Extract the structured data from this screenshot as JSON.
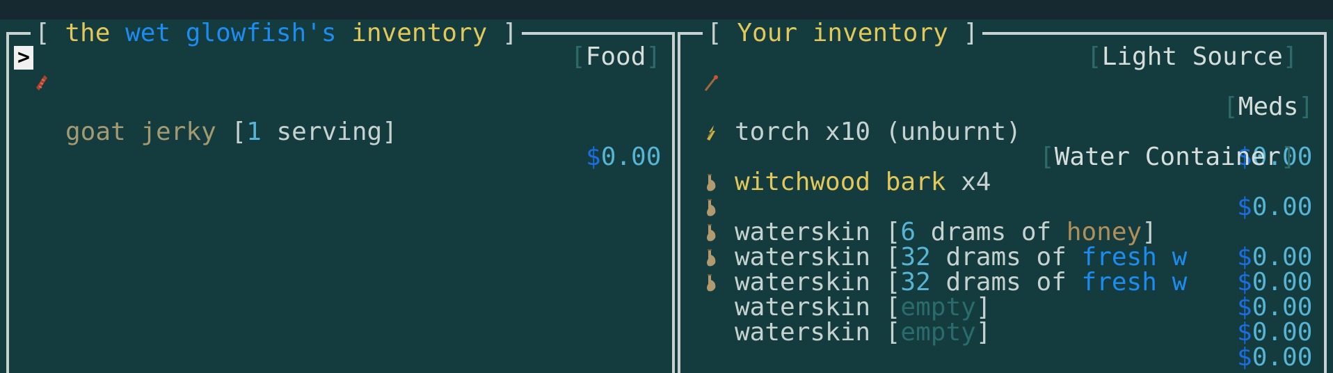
{
  "left": {
    "title_prefix": "[ ",
    "title_the": "the",
    "title_creature": "wet glowfish's",
    "title_inv": "inventory",
    "title_suffix": " ]",
    "cursor": ">",
    "category": "Food",
    "items": [
      {
        "icon": "jerky-icon",
        "name": "goat jerky",
        "detail_open": " [",
        "detail_val": "1",
        "detail_rest": " serving]",
        "price": "0.00"
      }
    ]
  },
  "right": {
    "title_prefix": "[ ",
    "title_text": "Your inventory",
    "title_suffix": " ]",
    "categories": [
      "Light Source",
      "Meds",
      "Water Container"
    ],
    "torch": {
      "name": "torch x10 (unburnt)",
      "price": "0.00"
    },
    "bark": {
      "name": "witchwood bark",
      "qty": " x4",
      "price": "0.00"
    },
    "waterskins": [
      {
        "prefix": "waterskin [",
        "num": "6",
        "mid": " drams of ",
        "liquid": "honey",
        "end": "]",
        "price": "0.00"
      },
      {
        "prefix": "waterskin [",
        "num": "32",
        "mid": " drams of ",
        "liquid": "fresh w",
        "end": "",
        "price": "0.00"
      },
      {
        "prefix": "waterskin [",
        "num": "32",
        "mid": " drams of ",
        "liquid": "fresh w",
        "end": "",
        "price": "0.00"
      },
      {
        "prefix": "waterskin [",
        "num": "",
        "mid": "",
        "liquid": "empty",
        "end": "]",
        "price": "0.00"
      },
      {
        "prefix": "waterskin [",
        "num": "",
        "mid": "",
        "liquid": "empty",
        "end": "]",
        "price": "0.00"
      }
    ]
  },
  "currency": "$"
}
